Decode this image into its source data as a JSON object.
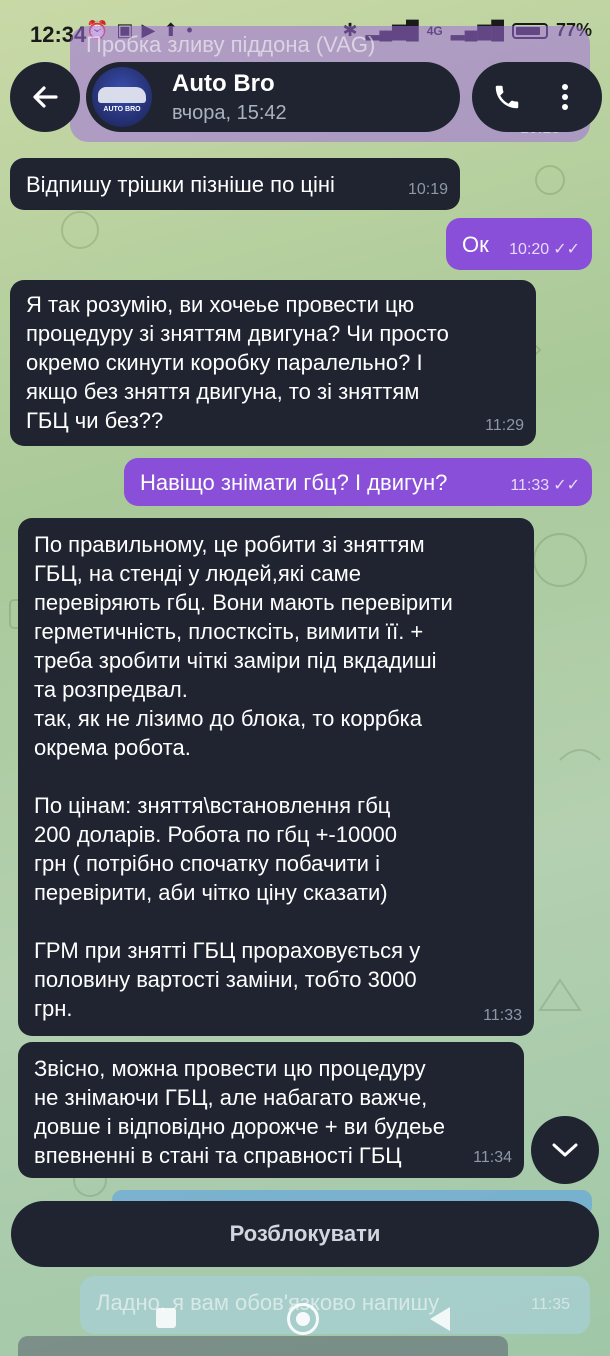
{
  "status_bar": {
    "time": "12:34",
    "network": "4G",
    "battery": "77%"
  },
  "pinned_preview": {
    "text": "Пробка зливу піддона (VAG)",
    "time": "10:18"
  },
  "header": {
    "title": "Auto Bro",
    "subtitle": "вчора, 15:42",
    "avatar_text": "AUTO BRO"
  },
  "messages": [
    {
      "direction": "in",
      "text": "Відпишу трішки пізніше по ціні",
      "time": "10:19"
    },
    {
      "direction": "out",
      "text": "Ок",
      "time": "10:20"
    },
    {
      "direction": "in",
      "text": "Я так розумію, ви хочеье провести цю\nпроцедуру зі зняттям двигуна? Чи просто\nокремо скинути коробку паралельно? І\nякщо без зняття двигуна, то зі зняттям\nГБЦ чи без??",
      "time": "11:29"
    },
    {
      "direction": "out",
      "text": "Навіщо знімати гбц? І двигун?",
      "time": "11:33"
    },
    {
      "direction": "in",
      "text": "По правильному, це робити зі зняттям\nГБЦ, на стенді у людей,які саме\nперевіряють гбц. Вони мають перевірити\nгерметичність, плостксіть, вимити її. +\nтреба зробити чіткі заміри під вкдадиші\nта розпредвал.\nтак, як не лізимо до блока, то коррбка\nокрема робота.\n\nПо цінам: зняття\\встановлення гбц\n200 доларів. Робота по гбц +-10000\nгрн ( потрібно спочатку побачити і\nперевірити, аби чітко ціну сказати)\n\nГРМ при знятті ГБЦ прораховується у\nполовину вартості заміни, тобто 3000\nгрн.",
      "time": "11:33"
    },
    {
      "direction": "in",
      "text": "Звісно, можна провести цю процедуру\nне знімаючи ГБЦ, але набагато важче,\nдовше і відповідно дорожче + ви будеье\nвпевненні в стані та справності ГБЦ",
      "time": "11:34"
    }
  ],
  "faded_bottom_message": {
    "text": "Ладно, я вам обов'язково напишу",
    "time": "11:35"
  },
  "unblock_label": "Розблокувати",
  "colors": {
    "incoming_bubble": "#1f2430",
    "outgoing_bubble": "#8a4fd9",
    "read_ticks": "#e6dbfa"
  },
  "icons": {
    "back": "arrow-left-icon",
    "call": "phone-icon",
    "menu": "more-vertical-icon",
    "scroll": "chevron-down-icon"
  }
}
